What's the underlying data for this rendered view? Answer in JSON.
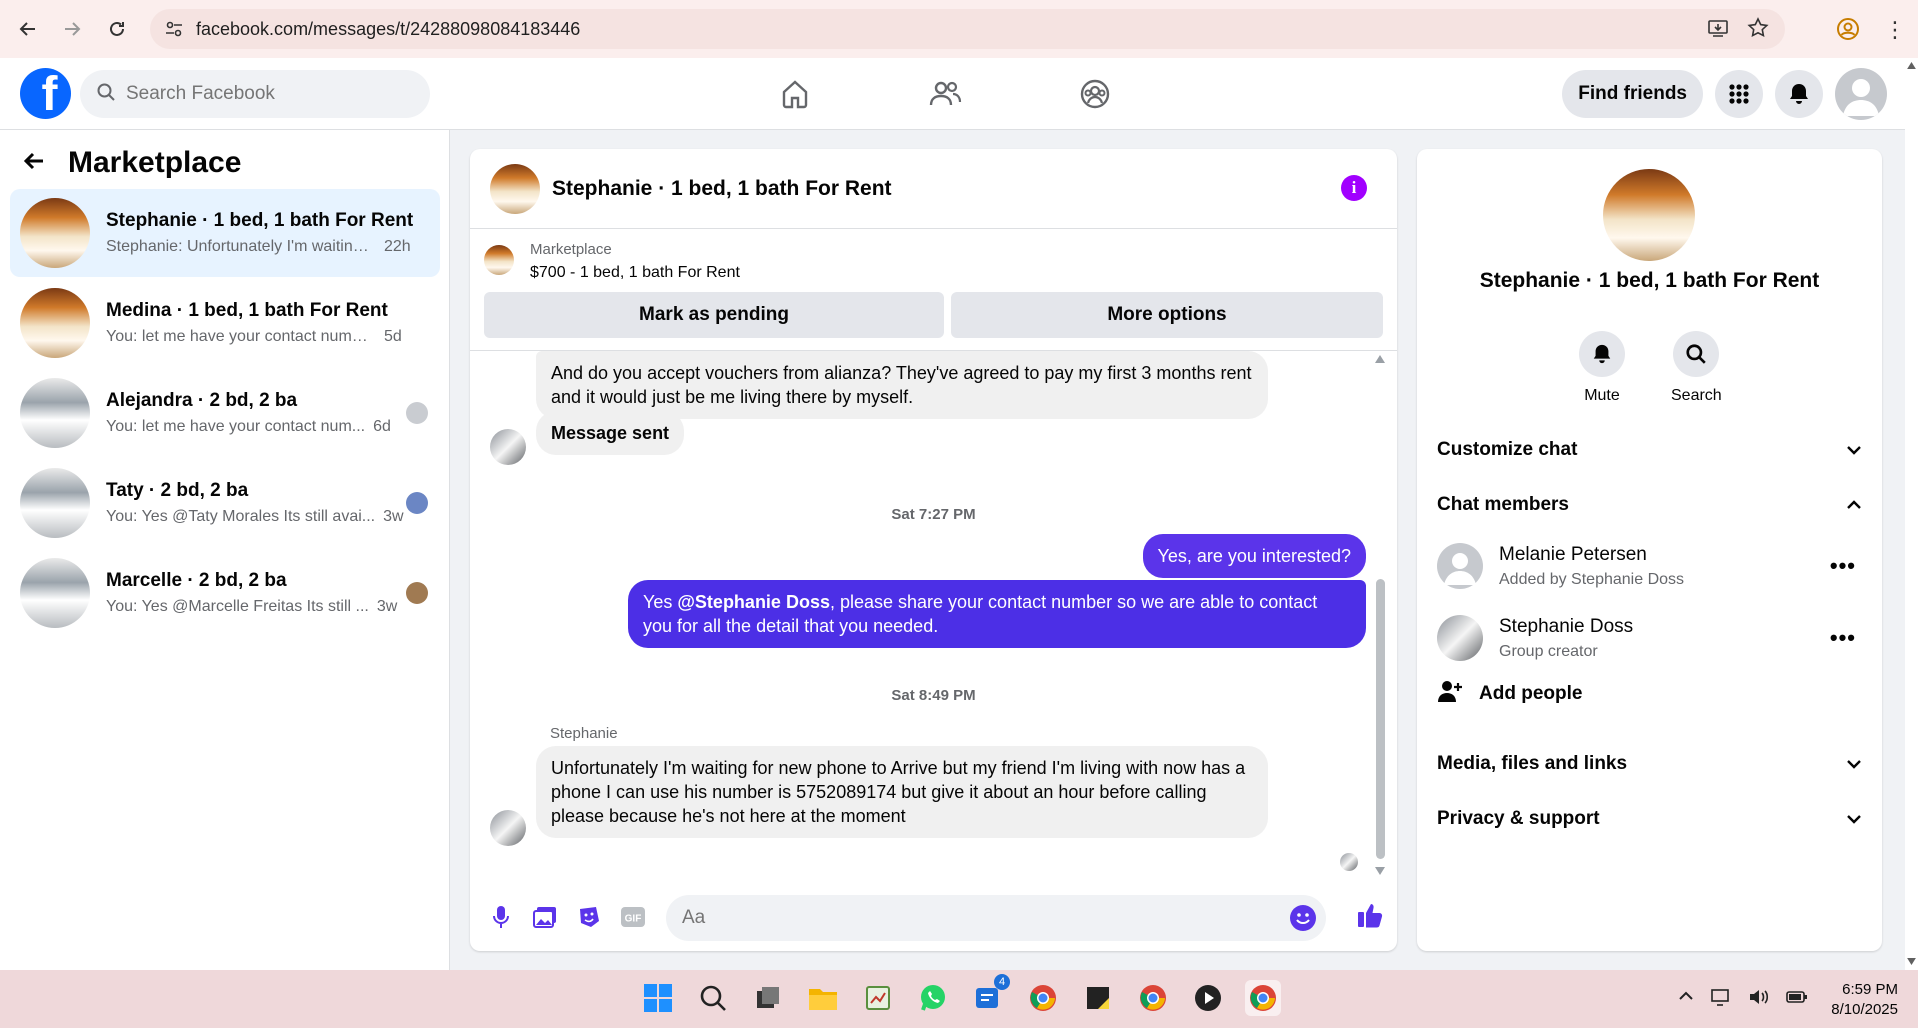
{
  "browser": {
    "url": "facebook.com/messages/t/24288098084183446"
  },
  "header": {
    "logo": "f",
    "search_placeholder": "Search Facebook",
    "find_friends": "Find friends"
  },
  "sidebar": {
    "title": "Marketplace",
    "conversations": [
      {
        "name": "Stephanie · 1 bed, 1 bath For Rent",
        "preview": "Stephanie: Unfortunately I'm waiting ...",
        "time": "22h"
      },
      {
        "name": "Medina · 1 bed, 1 bath For Rent",
        "preview": "You: let me have your contact number...",
        "time": "5d"
      },
      {
        "name": "Alejandra · 2 bd, 2 ba",
        "preview": "You: let me have your contact num...",
        "time": "6d"
      },
      {
        "name": "Taty · 2 bd, 2 ba",
        "preview": "You: Yes @Taty Morales Its still avai...",
        "time": "3w"
      },
      {
        "name": "Marcelle · 2 bd, 2 ba",
        "preview": "You: Yes @Marcelle Freitas Its still ...",
        "time": "3w"
      }
    ]
  },
  "chat": {
    "title": "Stephanie · 1 bed, 1 bath For Rent",
    "info_glyph": "i",
    "marketplace_label": "Marketplace",
    "listing": "$700 - 1 bed, 1 bath For Rent",
    "mark_pending": "Mark as pending",
    "more_options": "More options",
    "msg1": "And do you accept vouchers from alianza? They've agreed to pay my first 3 months rent and it would just be me living there by myself.",
    "msg2": "Message sent",
    "ts1": "Sat 7:27 PM",
    "out1": "Yes, are you interested?",
    "out2_prefix": "Yes ",
    "out2_mention": "@Stephanie Doss",
    "out2_rest": ", please share your contact number so we are able to contact you for all the detail that you needed.",
    "ts2": "Sat 8:49 PM",
    "sender": "Stephanie",
    "msg3": "Unfortunately I'm waiting for  new phone to Arrive but my friend I'm living with now has a phone I can use his number is 5752089174 but give it about an hour before calling please  because he's not here at the moment",
    "composer_placeholder": "Aa"
  },
  "details": {
    "title": "Stephanie · 1 bed, 1 bath For Rent",
    "mute": "Mute",
    "search": "Search",
    "customize": "Customize chat",
    "members_header": "Chat members",
    "members": [
      {
        "name": "Melanie Petersen",
        "sub": "Added by Stephanie Doss"
      },
      {
        "name": "Stephanie Doss",
        "sub": "Group creator"
      }
    ],
    "more_glyph": "•••",
    "add_people": "Add people",
    "media": "Media, files and links",
    "privacy": "Privacy & support"
  },
  "taskbar": {
    "time": "6:59 PM",
    "date": "8/10/2025",
    "badge": "4"
  },
  "colors": {
    "accent": "#5b34ea",
    "fb_blue": "#0866ff"
  }
}
